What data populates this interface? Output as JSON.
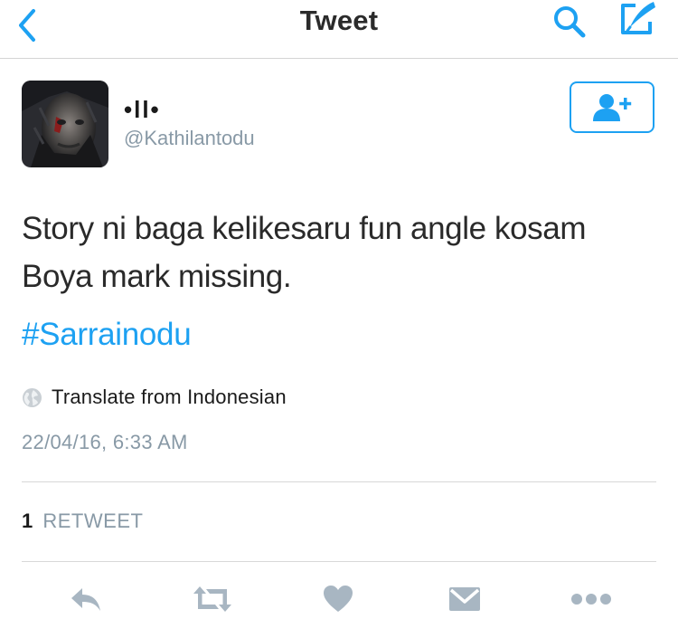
{
  "nav": {
    "title": "Tweet"
  },
  "author": {
    "name": "•ll•",
    "handle": "@Kathilantodu"
  },
  "tweet": {
    "text_line1": "Story ni baga kelikesaru fun angle kosam",
    "text_line2": "Boya mark missing.",
    "hashtag": "#Sarrainodu",
    "translate_label": "Translate from Indonesian",
    "timestamp": "22/04/16, 6:33 AM"
  },
  "stats": {
    "retweet_count": "1",
    "retweet_label": "RETWEET"
  },
  "colors": {
    "accent": "#1da1f2",
    "secondary_text": "#8899a6",
    "action_icon": "#a8b6c2"
  },
  "icons": [
    "back-icon",
    "search-icon",
    "compose-icon",
    "follow-icon",
    "globe-icon",
    "reply-icon",
    "retweet-icon",
    "like-icon",
    "message-icon",
    "more-icon"
  ]
}
